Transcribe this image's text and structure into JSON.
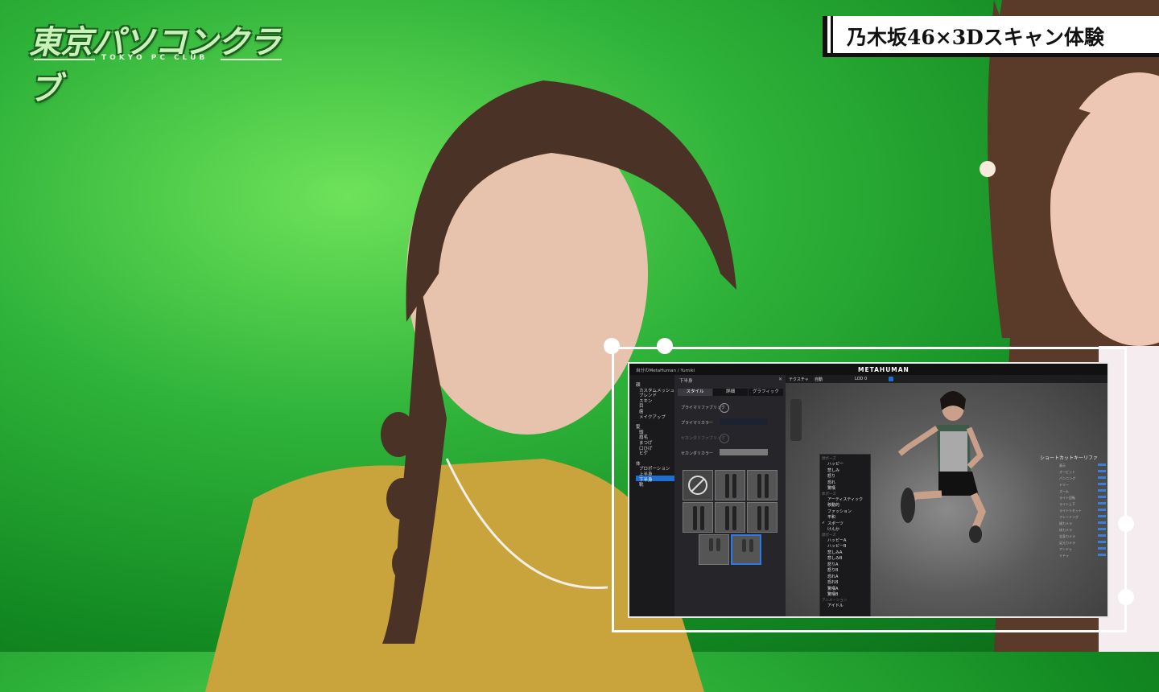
{
  "logo": {
    "main": "東京パソコンクラブ",
    "sub": "TOKYO PC CLUB"
  },
  "caption": {
    "text": "乃木坂46×3Dスキャン体験"
  },
  "app": {
    "breadcrumb": "自分のMetaHuman / Yumiki",
    "brand": "METAHUMAN",
    "sidebar": {
      "sections": [
        {
          "items": [
            "顔",
            "カスタムメッシュ",
            "ブレンド",
            "スキン",
            "目",
            "歯",
            "メイクアップ"
          ]
        },
        {
          "items": [
            "髪",
            "頭",
            "眉毛",
            "まつげ",
            "口ひげ",
            "ヒゲ"
          ]
        },
        {
          "items": [
            "体",
            "プロポーション",
            "上半身",
            "下半身",
            "靴"
          ]
        }
      ],
      "selected": "下半身"
    },
    "panel": {
      "title": "下半身",
      "tabs": [
        "スタイル",
        "詳細",
        "グラフィック"
      ],
      "rows": [
        "プライマリファブリック",
        "プライマリカラー",
        "セカンダリファブリック",
        "セカンダリカラー"
      ]
    },
    "viewport": {
      "toolbar": [
        "テクスチャ",
        "自動",
        "LOD 0"
      ],
      "menu": {
        "groups": [
          {
            "header": "顔ポーズ",
            "items": [
              "ハッピー",
              "悲しみ",
              "怒り",
              "恐れ",
              "驚嘆"
            ]
          },
          {
            "header": "体ポーズ",
            "items": [
              "アーティスティック",
              "移動的",
              "ファッション",
              "平和",
              "スポーツ",
              "けんか"
            ],
            "checked": "スポーツ"
          },
          {
            "header": "顔ポーズ",
            "items": [
              "ハッピーA",
              "ハッピーB",
              "悲しみA",
              "悲しみB",
              "怒りA",
              "怒りB",
              "恐れA",
              "恐れB",
              "驚嘆A",
              "驚嘆B"
            ]
          },
          {
            "header": "アニメーション",
            "items": [
              "アイドル"
            ]
          }
        ]
      },
      "shortcuts_title": "ショートカットキーリファ",
      "shortcut_rows": [
        "表示",
        "オービット",
        "パンニング",
        "ドリー",
        "ズーム",
        "ライト回転",
        "ライト上下",
        "ライトリセット",
        "フレーミング",
        "顔カメラ",
        "体カメラ",
        "全身カメラ",
        "足元カメラ",
        "アンドゥ",
        "リドゥ"
      ]
    }
  },
  "colors": {
    "green": "#2fb33a",
    "accent": "#1f6fd0"
  }
}
